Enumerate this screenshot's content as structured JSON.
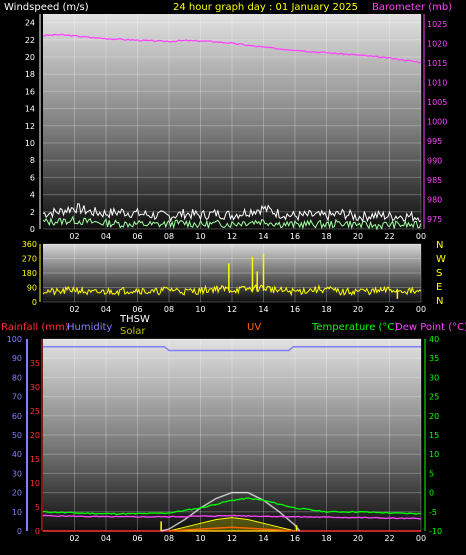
{
  "header": {
    "left_title": "Windspeed (m/s)",
    "center_title": "24 hour graph day : 01 January 2025",
    "right_title": "Barometer (mb)"
  },
  "colors": {
    "windspeed": "#ffffff",
    "gust": "#a0ffa0",
    "barometer": "#ff44ff",
    "direction": "#ffff00",
    "humidity": "#8080ff",
    "temperature": "#00ff00",
    "dewpoint": "#ff44ff",
    "thsw": "#ffffff",
    "solar": "#c0c000",
    "uv": "#ff6600",
    "rainfall": "#ff3030",
    "grid": "#ffffff",
    "chart_top": "#e0e0e0",
    "chart_bottom": "#101010"
  },
  "legend": {
    "rainfall": "Rainfall (mm)",
    "humidity": "Humidity",
    "thsw": "THSW",
    "solar": "Solar",
    "uv": "UV",
    "temperature": "Temperature (°C)",
    "dewpoint": "Dew Point (°C)"
  },
  "direction_letters": [
    "N",
    "W",
    "S",
    "E",
    "N"
  ],
  "chart_data": [
    {
      "type": "line",
      "title": "24 hour graph day : 01 January 2025",
      "ylabel": "Windspeed (m/s)",
      "y2label": "Barometer (mb)",
      "x_ticks": [
        "02",
        "04",
        "06",
        "08",
        "10",
        "12",
        "14",
        "16",
        "18",
        "20",
        "22",
        "00"
      ],
      "ylim": [
        0,
        25
      ],
      "y_ticks": [
        0,
        2,
        4,
        6,
        8,
        10,
        12,
        14,
        16,
        18,
        20,
        22,
        24
      ],
      "y2lim": [
        972.5,
        1027.5
      ],
      "y2_ticks": [
        975,
        980,
        985,
        990,
        995,
        1000,
        1005,
        1010,
        1015,
        1020,
        1025
      ],
      "series": [
        {
          "name": "Windspeed",
          "axis": "left",
          "x": [
            0,
            1,
            2,
            3,
            4,
            5,
            6,
            7,
            8,
            9,
            10,
            11,
            12,
            13,
            14,
            15,
            16,
            17,
            18,
            19,
            20,
            21,
            22,
            23,
            24
          ],
          "values": [
            1.8,
            2.0,
            2.5,
            2.0,
            1.8,
            2.0,
            1.8,
            1.6,
            1.5,
            1.8,
            1.6,
            1.8,
            1.6,
            2.0,
            2.4,
            1.8,
            1.5,
            1.6,
            1.5,
            1.8,
            1.4,
            1.6,
            1.5,
            1.5,
            1.4
          ]
        },
        {
          "name": "Gust",
          "axis": "left",
          "x": [
            0,
            1,
            2,
            3,
            4,
            5,
            6,
            7,
            8,
            9,
            10,
            11,
            12,
            13,
            14,
            15,
            16,
            17,
            18,
            19,
            20,
            21,
            22,
            23,
            24
          ],
          "values": [
            0.8,
            0.9,
            1.0,
            0.8,
            0.7,
            0.6,
            0.6,
            0.5,
            0.6,
            0.7,
            0.5,
            0.6,
            0.6,
            0.8,
            0.9,
            0.6,
            0.5,
            0.6,
            0.5,
            0.7,
            0.5,
            0.4,
            0.5,
            0.5,
            0.4
          ]
        },
        {
          "name": "Barometer",
          "axis": "right",
          "x": [
            0,
            1,
            2,
            3,
            4,
            5,
            6,
            7,
            8,
            9,
            10,
            11,
            12,
            13,
            14,
            15,
            16,
            17,
            18,
            19,
            20,
            21,
            22,
            23,
            24
          ],
          "values": [
            1022.0,
            1022.2,
            1021.9,
            1021.5,
            1021.2,
            1021.0,
            1020.8,
            1020.6,
            1020.5,
            1020.7,
            1020.6,
            1020.4,
            1020.0,
            1019.5,
            1019.0,
            1018.6,
            1018.3,
            1017.9,
            1017.6,
            1017.3,
            1017.0,
            1016.6,
            1016.2,
            1015.7,
            1015.1
          ]
        }
      ]
    },
    {
      "type": "line",
      "title": "",
      "ylabel": "",
      "x_ticks": [
        "02",
        "04",
        "06",
        "08",
        "10",
        "12",
        "14",
        "16",
        "18",
        "20",
        "22",
        "00"
      ],
      "ylim": [
        0,
        360
      ],
      "y_ticks": [
        0,
        90,
        180,
        270,
        360
      ],
      "series": [
        {
          "name": "Wind Direction",
          "x": [
            0,
            1,
            2,
            3,
            4,
            5,
            6,
            7,
            8,
            9,
            10,
            11,
            12,
            13,
            14,
            15,
            16,
            17,
            18,
            19,
            20,
            21,
            22,
            23,
            24
          ],
          "values": [
            70,
            60,
            80,
            55,
            65,
            70,
            75,
            60,
            80,
            65,
            70,
            85,
            75,
            80,
            90,
            70,
            65,
            75,
            80,
            60,
            70,
            65,
            75,
            70,
            60
          ]
        }
      ],
      "spikes": [
        {
          "x": 11.8,
          "value": 240
        },
        {
          "x": 13.3,
          "value": 280
        },
        {
          "x": 13.6,
          "value": 190
        },
        {
          "x": 14.0,
          "value": 300
        },
        {
          "x": 22.5,
          "value": 20
        }
      ]
    },
    {
      "type": "line",
      "title": "",
      "x_ticks": [
        "02",
        "04",
        "06",
        "08",
        "10",
        "12",
        "14",
        "16",
        "18",
        "20",
        "22",
        "00"
      ],
      "left_axis": {
        "label": "Humidity",
        "ylim": [
          0,
          100
        ],
        "ticks": [
          0,
          10,
          20,
          30,
          40,
          50,
          60,
          70,
          80,
          90,
          100
        ]
      },
      "inner_left_axis": {
        "label": "Rainfall (mm)",
        "ylim": [
          0,
          40
        ],
        "ticks": [
          0,
          5,
          10,
          15,
          20,
          25,
          30,
          35
        ]
      },
      "right_axis": {
        "label": "Temperature (°C)",
        "ylim": [
          -10,
          40
        ],
        "ticks": [
          -10,
          -5,
          0,
          5,
          10,
          15,
          20,
          25,
          30,
          35,
          40
        ]
      },
      "series": [
        {
          "name": "Humidity",
          "axis": "left",
          "x": [
            0,
            6,
            7.7,
            8.0,
            14,
            15.6,
            15.9,
            24
          ],
          "values": [
            96,
            96,
            96,
            94,
            94,
            94,
            96,
            96
          ]
        },
        {
          "name": "Temperature",
          "axis": "right",
          "x": [
            0,
            2,
            4,
            6,
            8,
            10,
            12,
            13,
            14,
            16,
            18,
            20,
            22,
            24
          ],
          "values": [
            -5,
            -5.3,
            -5.5,
            -5.5,
            -5.3,
            -4,
            -2,
            -1.5,
            -2,
            -4,
            -5,
            -5,
            -5.3,
            -5.5
          ]
        },
        {
          "name": "Dew Point",
          "axis": "right",
          "x": [
            0,
            4,
            8,
            12,
            16,
            20,
            24
          ],
          "values": [
            -6,
            -6.3,
            -6.3,
            -6,
            -6.3,
            -6.5,
            -6.8
          ]
        },
        {
          "name": "THSW",
          "axis": "right",
          "x": [
            7.5,
            8,
            9,
            10,
            11,
            12,
            13,
            14,
            15,
            16,
            16.3
          ],
          "values": [
            -10,
            -9.5,
            -7,
            -4,
            -1.5,
            0,
            0,
            -2,
            -5,
            -8.5,
            -10
          ]
        },
        {
          "name": "Solar",
          "axis": "right",
          "x": [
            8,
            9,
            10,
            11,
            12,
            13,
            14,
            15,
            16
          ],
          "values": [
            -10,
            -9,
            -8,
            -7,
            -6.5,
            -7,
            -8,
            -9,
            -10
          ]
        },
        {
          "name": "UV",
          "axis": "right",
          "x": [
            8,
            10,
            12,
            14,
            16
          ],
          "values": [
            -10,
            -9.5,
            -9,
            -9.5,
            -10
          ]
        },
        {
          "name": "Rainfall",
          "axis": "inner_left",
          "x": [
            0,
            24
          ],
          "values": [
            0,
            0
          ]
        }
      ],
      "markers": [
        {
          "name": "Solar",
          "x": 7.5,
          "value": -7.5
        },
        {
          "name": "Solar",
          "x": 16.1,
          "value": -8.5
        }
      ]
    }
  ]
}
